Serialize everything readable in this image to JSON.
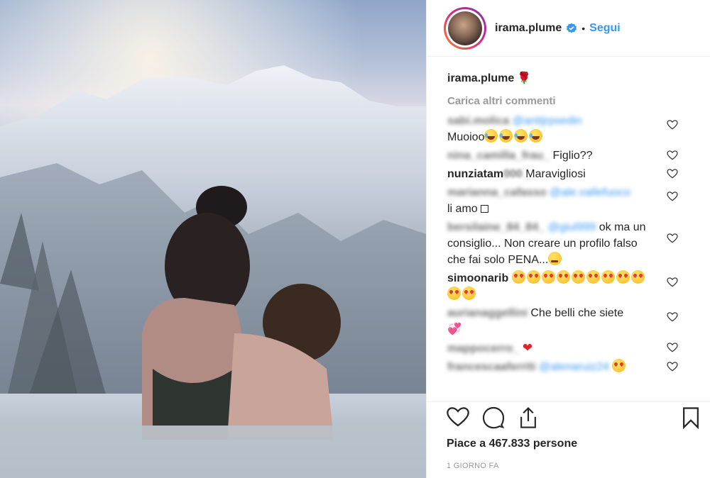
{
  "post": {
    "username": "irama.plume",
    "follow_label": "Segui",
    "separator": "•",
    "caption_user": "irama.plume",
    "caption_emoji": "🌹",
    "load_more": "Carica altri commenti",
    "likes": "Piace a 467.833 persone",
    "timestamp": "1 GIORNO FA"
  },
  "comments": [
    {
      "user": "sabi.molica",
      "mention": "@antijrpsedin",
      "text": "Muoioo"
    },
    {
      "user": "nina_camilla_frau_",
      "text": "Figlio??"
    },
    {
      "user": "nunziatam000",
      "text": "Maravigliosi"
    },
    {
      "user": "marianna_cafasso",
      "mention": "@ale.vallefuoco",
      "text": "li amo"
    },
    {
      "user": "bersilaine_84_84_",
      "mention": "@giul999",
      "text": "ok ma un consiglio... Non creare un profilo falso che fai solo PENA..."
    },
    {
      "user": "simoonarib",
      "text": ""
    },
    {
      "user": "aurianaggellini",
      "text": "Che belli che siete"
    },
    {
      "user": "mappocerro_",
      "text": ""
    },
    {
      "user": "francescaaferriti",
      "mention": "@alenaruiz24",
      "text": ""
    }
  ],
  "icons": {
    "verified": "verified-badge-icon",
    "like": "heart-icon",
    "comment": "comment-bubble-icon",
    "share": "share-icon",
    "save": "bookmark-icon",
    "comment_like": "heart-outline-icon"
  },
  "colors": {
    "accent": "#3897f0",
    "text": "#262626",
    "muted": "#999999",
    "border": "#efefef"
  }
}
